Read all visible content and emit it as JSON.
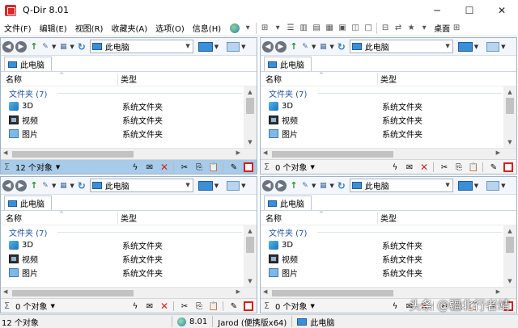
{
  "window": {
    "title": "Q-Dir 8.01",
    "minimize": "─",
    "maximize": "☐",
    "close": "✕"
  },
  "menu": {
    "items": [
      "文件(F)",
      "编辑(E)",
      "视图(R)",
      "收藏夹(A)",
      "选项(O)",
      "信息(H)"
    ],
    "desktop_label": "桌面"
  },
  "panes": [
    {
      "address": "此电脑",
      "tab": "此电脑",
      "col_name": "名称",
      "col_type": "类型",
      "group": "文件夹 (7)",
      "files": [
        {
          "name": "3D",
          "type": "系统文件夹",
          "icon": "3d-objects-icon"
        },
        {
          "name": "视频",
          "type": "系统文件夹",
          "icon": "video-folder-icon"
        },
        {
          "name": "图片",
          "type": "系统文件夹",
          "icon": "pictures-folder-icon"
        }
      ],
      "status": "12 个对象",
      "active": true
    },
    {
      "address": "此电脑",
      "tab": "此电脑",
      "col_name": "名称",
      "col_type": "类型",
      "group": "文件夹 (7)",
      "files": [
        {
          "name": "3D",
          "type": "系统文件夹",
          "icon": "3d-objects-icon"
        },
        {
          "name": "视频",
          "type": "系统文件夹",
          "icon": "video-folder-icon"
        },
        {
          "name": "图片",
          "type": "系统文件夹",
          "icon": "pictures-folder-icon"
        }
      ],
      "status": "0 个对象",
      "active": false
    },
    {
      "address": "此电脑",
      "tab": "此电脑",
      "col_name": "名称",
      "col_type": "类型",
      "group": "文件夹 (7)",
      "files": [
        {
          "name": "3D",
          "type": "系统文件夹",
          "icon": "3d-objects-icon"
        },
        {
          "name": "视频",
          "type": "系统文件夹",
          "icon": "video-folder-icon"
        },
        {
          "name": "图片",
          "type": "系统文件夹",
          "icon": "pictures-folder-icon"
        }
      ],
      "status": "0 个对象",
      "active": false
    },
    {
      "address": "此电脑",
      "tab": "此电脑",
      "col_name": "名称",
      "col_type": "类型",
      "group": "文件夹 (7)",
      "files": [
        {
          "name": "3D",
          "type": "系统文件夹",
          "icon": "3d-objects-icon"
        },
        {
          "name": "视频",
          "type": "系统文件夹",
          "icon": "video-folder-icon"
        },
        {
          "name": "图片",
          "type": "系统文件夹",
          "icon": "pictures-folder-icon"
        }
      ],
      "status": "0 个对象",
      "active": false
    }
  ],
  "statusbar": {
    "count": "12 个对象",
    "version": "8.01",
    "user": "Jarod (便携版x64)",
    "location": "此电脑"
  },
  "watermark": "头条 @疆北行者靖",
  "colors": {
    "active_status": "#a7cbe8",
    "group_text": "#2355a0",
    "delete_red": "#d81e1e"
  }
}
